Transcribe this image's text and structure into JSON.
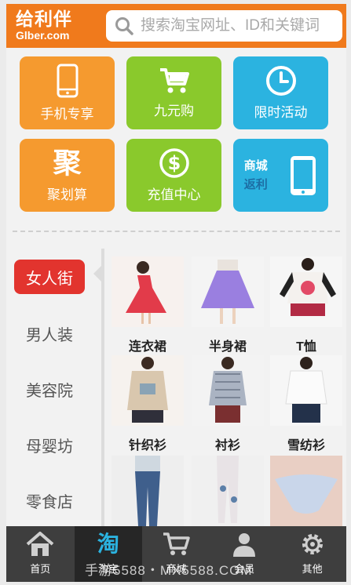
{
  "header": {
    "logo_cn": "给利伴",
    "logo_en": "Glber.com",
    "search_placeholder": "搜索淘宝网址、ID和关键词"
  },
  "tiles": [
    {
      "label": "手机专享",
      "icon": "phone-icon",
      "color": "#f59a2f"
    },
    {
      "label": "九元购",
      "icon": "cart-icon",
      "color": "#8ac92c"
    },
    {
      "label": "限时活动",
      "icon": "clock-icon",
      "color": "#2bb3e0"
    },
    {
      "label": "聚划算",
      "icon": "ju-glyph",
      "glyph": "聚",
      "color": "#f59a2f"
    },
    {
      "label": "充值中心",
      "icon": "dollar-icon",
      "color": "#8ac92c"
    },
    {
      "label_line1": "商城",
      "label_line2": "返利",
      "icon": "tablet-icon",
      "color": "#2bb3e0"
    }
  ],
  "categories": [
    "女人街",
    "男人装",
    "美容院",
    "母婴坊",
    "零食店"
  ],
  "active_category": "女人街",
  "products": [
    "连衣裙",
    "半身裙",
    "T恤",
    "针织衫",
    "衬衫",
    "雪纺衫"
  ],
  "nav": [
    {
      "label": "首页",
      "icon": "home-icon"
    },
    {
      "label": "淘宝",
      "icon": "taobao-icon",
      "glyph": "淘"
    },
    {
      "label": "商城",
      "icon": "cart-icon"
    },
    {
      "label": "会员",
      "icon": "user-icon"
    },
    {
      "label": "其他",
      "icon": "gear-icon"
    }
  ],
  "watermark": "手游5588・MX5588.COM"
}
